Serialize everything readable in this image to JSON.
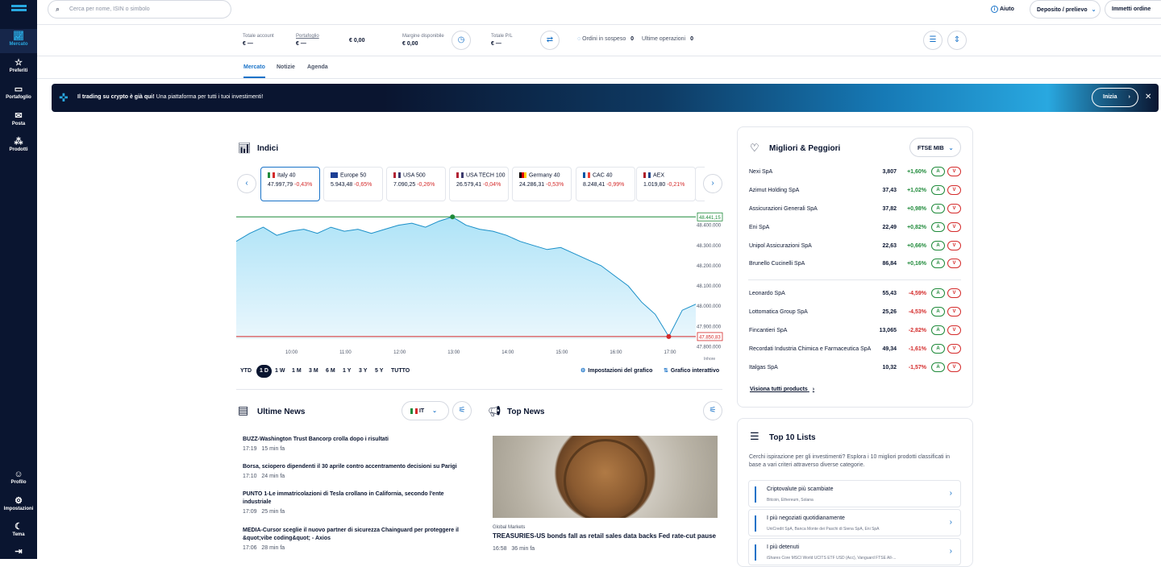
{
  "sidebar": {
    "items": [
      {
        "label": "Mercato",
        "icon": "chart-icon"
      },
      {
        "label": "Preferiti",
        "icon": "star-icon"
      },
      {
        "label": "Portafoglio",
        "icon": "portfolio-icon"
      },
      {
        "label": "Posta",
        "icon": "mail-icon"
      },
      {
        "label": "Prodotti",
        "icon": "products-icon"
      }
    ],
    "bottom": [
      {
        "label": "Profilo",
        "icon": "user-icon"
      },
      {
        "label": "Impostazioni",
        "icon": "gear-icon"
      },
      {
        "label": "Tema",
        "icon": "theme-icon"
      }
    ]
  },
  "topbar": {
    "search_placeholder": "Cerca per nome, ISIN o simbolo",
    "help": "Aiuto",
    "deposit": "Deposito / prelievo",
    "order": "Immetti ordine"
  },
  "summary": {
    "total_label": "Totale account",
    "total_value": "€ —",
    "portfolio_label": "Portafoglio",
    "portfolio_value": "€ —",
    "cash_value": "€ 0,00",
    "margin_label": "Margine disponibile",
    "margin_value": "€ 0,00",
    "pl_label": "Totale P/L",
    "pl_value": "€ —",
    "pending_label": "Ordini in sospeso",
    "pending_value": "0",
    "last_label": "Ultime operazioni",
    "last_value": "0"
  },
  "tabs": [
    "Mercato",
    "Notizie",
    "Agenda"
  ],
  "banner": {
    "bold": "Il trading su crypto è già qui!",
    "text": "Una piattaforma per tutti i tuoi investimenti!",
    "button": "Inizia"
  },
  "indices": {
    "title": "Indici",
    "cards": [
      {
        "name": "Italy 40",
        "value": "47.997,79",
        "change": "-0,43%",
        "flag": [
          "#1f8a3a",
          "#ffffff",
          "#d42b2b"
        ]
      },
      {
        "name": "Europe 50",
        "value": "5.943,48",
        "change": "-0,65%",
        "flag": [
          "#1c3f94",
          "#1c3f94",
          "#1c3f94"
        ]
      },
      {
        "name": "USA 500",
        "value": "7.090,25",
        "change": "-0,26%",
        "flag": [
          "#b22234",
          "#ffffff",
          "#3c3b6e"
        ]
      },
      {
        "name": "USA TECH 100",
        "value": "26.579,41",
        "change": "-0,04%",
        "flag": [
          "#b22234",
          "#ffffff",
          "#3c3b6e"
        ]
      },
      {
        "name": "Germany 40",
        "value": "24.286,31",
        "change": "-0,53%",
        "flag": [
          "#000000",
          "#dd0000",
          "#ffce00"
        ]
      },
      {
        "name": "CAC 40",
        "value": "8.248,41",
        "change": "-0,99%",
        "flag": [
          "#0055a4",
          "#ffffff",
          "#ef4135"
        ]
      },
      {
        "name": "AEX",
        "value": "1.019,80",
        "change": "-0,21%",
        "flag": [
          "#ae1c28",
          "#ffffff",
          "#21468b"
        ]
      }
    ]
  },
  "chart_data": {
    "type": "area",
    "x": [
      "09:00",
      "09:15",
      "09:30",
      "09:45",
      "10:00",
      "10:15",
      "10:30",
      "10:45",
      "11:00",
      "11:15",
      "11:30",
      "11:45",
      "12:00",
      "12:15",
      "12:30",
      "12:45",
      "13:00",
      "13:15",
      "13:30",
      "13:45",
      "14:00",
      "14:15",
      "14:30",
      "14:45",
      "15:00",
      "15:15",
      "15:30",
      "15:45",
      "16:00",
      "16:15",
      "16:30",
      "16:45",
      "17:00",
      "17:15",
      "17:30"
    ],
    "y": [
      48320,
      48360,
      48390,
      48350,
      48370,
      48380,
      48360,
      48390,
      48370,
      48380,
      48360,
      48380,
      48400,
      48410,
      48390,
      48420,
      48441,
      48400,
      48380,
      48370,
      48350,
      48320,
      48300,
      48280,
      48290,
      48260,
      48230,
      48200,
      48150,
      48100,
      48020,
      47960,
      47850,
      47980,
      48010
    ],
    "y_ticks": [
      "48.400.000",
      "48.300.000",
      "48.200.000",
      "48.100.000",
      "48.000.000",
      "47.900.000",
      "47.800.000"
    ],
    "x_ticks": [
      "10:00",
      "11:00",
      "12:00",
      "13:00",
      "14:00",
      "15:00",
      "16:00",
      "17:00"
    ],
    "high_label": "48.441,15",
    "low_label": "47.850,83",
    "ylim": [
      47790,
      48470
    ],
    "xlabel": "Inhore"
  },
  "periods": [
    "YTD",
    "1 D",
    "1 W",
    "1 M",
    "3 M",
    "6 M",
    "1 Y",
    "3 Y",
    "5 Y",
    "TUTTO"
  ],
  "chart_controls": {
    "settings": "Impostazioni del grafico",
    "interactive": "Grafico interattivo"
  },
  "news": {
    "title": "Ultime News",
    "lang": "IT",
    "items": [
      {
        "headline": "BUZZ-Washington Trust Bancorp crolla dopo i risultati",
        "time": "17:19",
        "ago": "15 min fa"
      },
      {
        "headline": "Borsa, sciopero dipendenti il 30 aprile contro accentramento decisioni su Parigi",
        "time": "17:10",
        "ago": "24 min fa"
      },
      {
        "headline": "PUNTO 1-Le immatricolazioni di Tesla crollano in California, secondo l'ente industriale",
        "time": "17:09",
        "ago": "25 min fa"
      },
      {
        "headline": "MEDIA-Cursor sceglie il nuovo partner di sicurezza Chainguard per proteggere il &quot;vibe coding&quot; - Axios",
        "time": "17:06",
        "ago": "28 min fa"
      }
    ]
  },
  "top_news": {
    "title": "Top News",
    "category": "Global Markets",
    "headline": "TREASURIES-US bonds fall as retail sales data backs Fed rate-cut pause",
    "time": "16:58",
    "ago": "36 min fa"
  },
  "movers": {
    "title": "Migliori & Peggiori",
    "selector": "FTSE MIB",
    "buy": "A",
    "sell": "V",
    "best": [
      {
        "name": "Nexi SpA",
        "price": "3,807",
        "change": "+1,60%"
      },
      {
        "name": "Azimut Holding SpA",
        "price": "37,43",
        "change": "+1,02%"
      },
      {
        "name": "Assicurazioni Generali SpA",
        "price": "37,82",
        "change": "+0,98%"
      },
      {
        "name": "Eni SpA",
        "price": "22,49",
        "change": "+0,82%"
      },
      {
        "name": "Unipol Assicurazioni SpA",
        "price": "22,63",
        "change": "+0,66%"
      },
      {
        "name": "Brunello Cucinelli SpA",
        "price": "86,84",
        "change": "+0,16%"
      }
    ],
    "worst": [
      {
        "name": "Leonardo SpA",
        "price": "55,43",
        "change": "-4,59%"
      },
      {
        "name": "Lottomatica Group SpA",
        "price": "25,26",
        "change": "-4,53%"
      },
      {
        "name": "Fincantieri SpA",
        "price": "13,065",
        "change": "-2,82%"
      },
      {
        "name": "Recordati Industria Chimica e Farmaceutica SpA",
        "price": "49,34",
        "change": "-1,61%"
      },
      {
        "name": "Italgas SpA",
        "price": "10,32",
        "change": "-1,57%"
      }
    ],
    "view_all": "Visiona tutti products"
  },
  "top10": {
    "title": "Top 10 Lists",
    "desc": "Cerchi ispirazione per gli investimenti? Esplora i 10 migliori prodotti classificati in base a vari criteri attraverso diverse categorie.",
    "lists": [
      {
        "title": "Criptovalute più scambiate",
        "sub": "Bitcoin, Ethereum, Solana"
      },
      {
        "title": "I più negoziati quotidianamente",
        "sub": "UniCredit SpA, Banca Monte dei Paschi di Siena SpA, Eni SpA"
      },
      {
        "title": "I più detenuti",
        "sub": "iShares Core MSCI World UCITS ETF USD (Acc), Vanguard FTSE All-..."
      }
    ]
  }
}
